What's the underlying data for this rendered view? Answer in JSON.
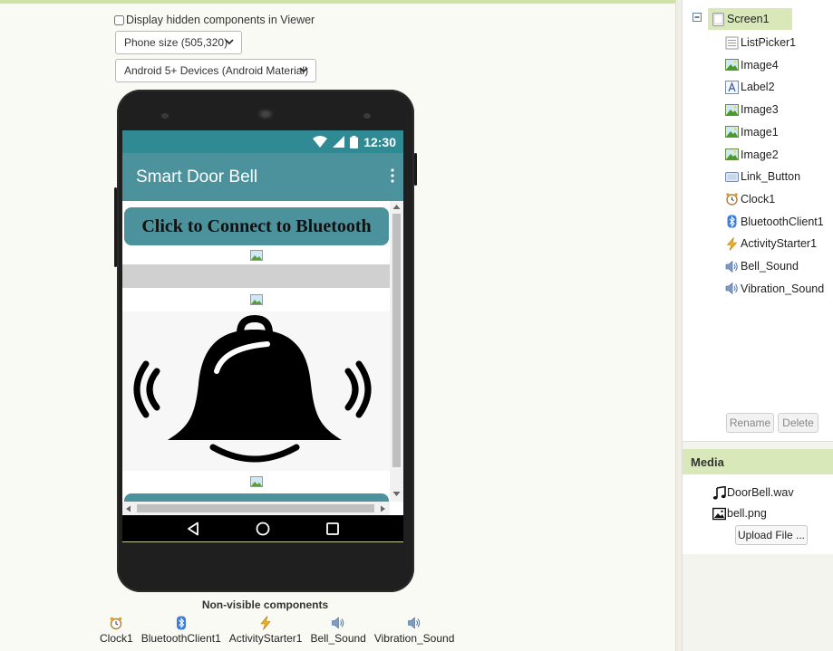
{
  "viewer": {
    "hidden_components_label": "Display hidden components in Viewer",
    "phone_size_select": "Phone size (505,320)",
    "theme_select": "Android 5+ Devices (Android Material)"
  },
  "phone": {
    "status_time": "12:30",
    "app_title": "Smart Door Bell",
    "connect_button_label": "Click to Connect to Bluetooth"
  },
  "non_visible": {
    "title": "Non-visible components",
    "items": [
      "Clock1",
      "BluetoothClient1",
      "ActivityStarter1",
      "Bell_Sound",
      "Vibration_Sound"
    ]
  },
  "components": {
    "root": "Screen1",
    "items": [
      "ListPicker1",
      "Image4",
      "Label2",
      "Image3",
      "Image1",
      "Image2",
      "Link_Button",
      "Clock1",
      "BluetoothClient1",
      "ActivityStarter1",
      "Bell_Sound",
      "Vibration_Sound"
    ],
    "icons": [
      "listpicker-icon",
      "image-icon",
      "label-icon",
      "image-icon",
      "image-icon",
      "image-icon",
      "button-icon",
      "clock-icon",
      "bluetooth-icon",
      "activity-starter-icon",
      "sound-icon",
      "sound-icon"
    ],
    "rename_label": "Rename",
    "delete_label": "Delete"
  },
  "media": {
    "title": "Media",
    "files": [
      "DoorBell.wav",
      "bell.png"
    ],
    "upload_label": "Upload File ..."
  },
  "colors": {
    "app_bar": "#4b929c",
    "status_bar": "#2f8a93",
    "selected_row": "#d8e8b8",
    "top_accent": "#cfe3a6"
  }
}
